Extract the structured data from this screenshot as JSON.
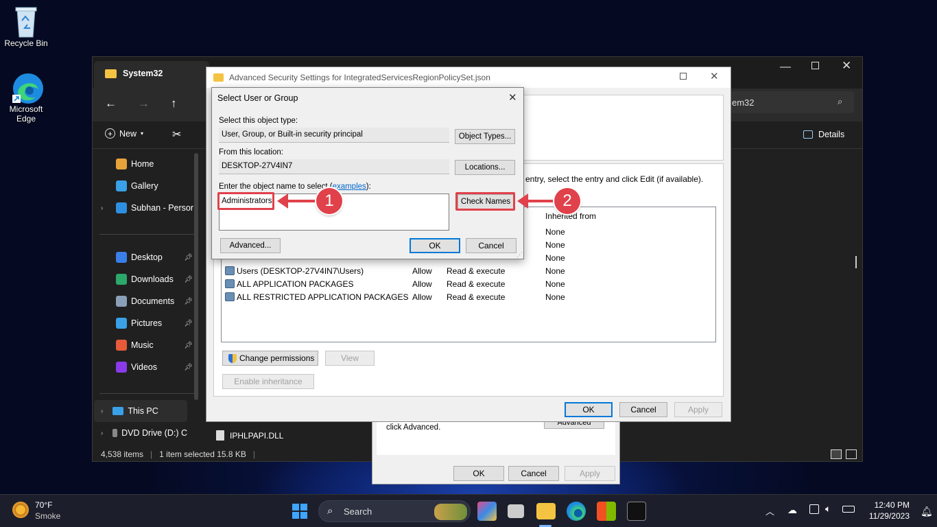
{
  "desktop": {
    "recycle_bin": "Recycle Bin",
    "edge_line1": "Microsoft",
    "edge_line2": "Edge"
  },
  "explorer": {
    "tab_title": "System32",
    "search_value": "em32",
    "cmd_new": "New",
    "cmd_details": "Details",
    "sidebar": [
      {
        "label": "Home",
        "color": "#e8a23a",
        "pinned": false,
        "chevron": false
      },
      {
        "label": "Gallery",
        "color": "#3aa0e8",
        "pinned": false,
        "chevron": false
      },
      {
        "label": "Subhan - Persor",
        "color": "#2e8fe0",
        "pinned": false,
        "chevron": true
      }
    ],
    "quick": [
      {
        "label": "Desktop",
        "color": "#3a7ee8"
      },
      {
        "label": "Downloads",
        "color": "#2ba86a"
      },
      {
        "label": "Documents",
        "color": "#8aa0b8"
      },
      {
        "label": "Pictures",
        "color": "#3aa0e8"
      },
      {
        "label": "Music",
        "color": "#e85a3a"
      },
      {
        "label": "Videos",
        "color": "#8a3ae8"
      }
    ],
    "this_pc": "This PC",
    "dvd": "DVD Drive (D:) C",
    "file_name": "IPHLPAPI.DLL",
    "status_items": "4,538 items",
    "status_selected": "1 item selected  15.8 KB"
  },
  "advanced": {
    "title": "Advanced Security Settings for IntegratedServicesRegionPolicySet.json",
    "hint_text": "entry, select the entry and click Edit (if available).",
    "col_inherited": "Inherited from",
    "rows": [
      {
        "principal": "",
        "access": "",
        "applies": "",
        "inherited": "None"
      },
      {
        "principal": "",
        "access": "",
        "applies": "",
        "inherited": "None"
      },
      {
        "principal": "",
        "access": "",
        "applies": "",
        "inherited": "None"
      },
      {
        "principal": "Users (DESKTOP-27V4IN7\\Users)",
        "access": "Allow",
        "applies": "Read & execute",
        "inherited": "None"
      },
      {
        "principal": "ALL APPLICATION PACKAGES",
        "access": "Allow",
        "applies": "Read & execute",
        "inherited": "None"
      },
      {
        "principal": "ALL RESTRICTED APPLICATION PACKAGES",
        "access": "Allow",
        "applies": "Read & execute",
        "inherited": "None"
      }
    ],
    "change_permissions": "Change permissions",
    "view": "View",
    "enable_inheritance": "Enable inheritance",
    "ok": "OK",
    "cancel": "Cancel",
    "apply": "Apply"
  },
  "behind_dialog": {
    "text": "click Advanced.",
    "advanced": "Advanced",
    "ok": "OK",
    "cancel": "Cancel",
    "apply": "Apply"
  },
  "select": {
    "title": "Select User or Group",
    "object_type_label": "Select this object type:",
    "object_type_value": "User, Group, or Built-in security principal",
    "object_types_button": "Object Types...",
    "location_label": "From this location:",
    "location_value": "DESKTOP-27V4IN7",
    "locations_button": "Locations...",
    "enter_label_prefix": "Enter the object name to select (",
    "examples_link": "examples",
    "enter_label_suffix": "):",
    "object_name_value": "Administrators",
    "check_names": "Check Names",
    "advanced": "Advanced...",
    "ok": "OK",
    "cancel": "Cancel"
  },
  "annotations": {
    "step1": "1",
    "step2": "2",
    "color": "#e0414b"
  },
  "taskbar": {
    "weather_temp": "70°F",
    "weather_desc": "Smoke",
    "search_label": "Search",
    "time": "12:40 PM",
    "date": "11/29/2023"
  }
}
